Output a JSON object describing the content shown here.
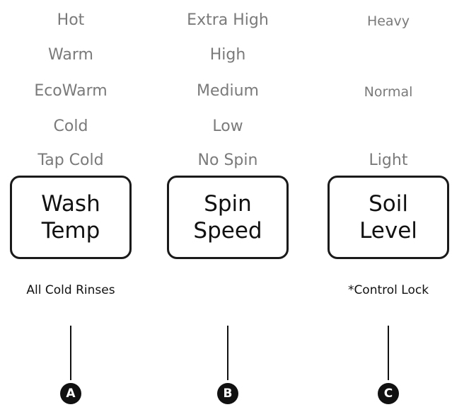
{
  "columns": [
    {
      "options": [
        "Hot",
        "Warm",
        "EcoWarm",
        "Cold",
        "Tap Cold"
      ],
      "button_lines": [
        "Wash",
        "Temp"
      ],
      "sub_label": "All Cold Rinses",
      "marker": "A"
    },
    {
      "options": [
        "Extra High",
        "High",
        "Medium",
        "Low",
        "No Spin"
      ],
      "button_lines": [
        "Spin",
        "Speed"
      ],
      "sub_label": "",
      "marker": "B"
    },
    {
      "options": [
        "Heavy",
        "Normal",
        "Light"
      ],
      "button_lines": [
        "Soil",
        "Level"
      ],
      "sub_label": "*Control Lock",
      "marker": "C"
    }
  ]
}
